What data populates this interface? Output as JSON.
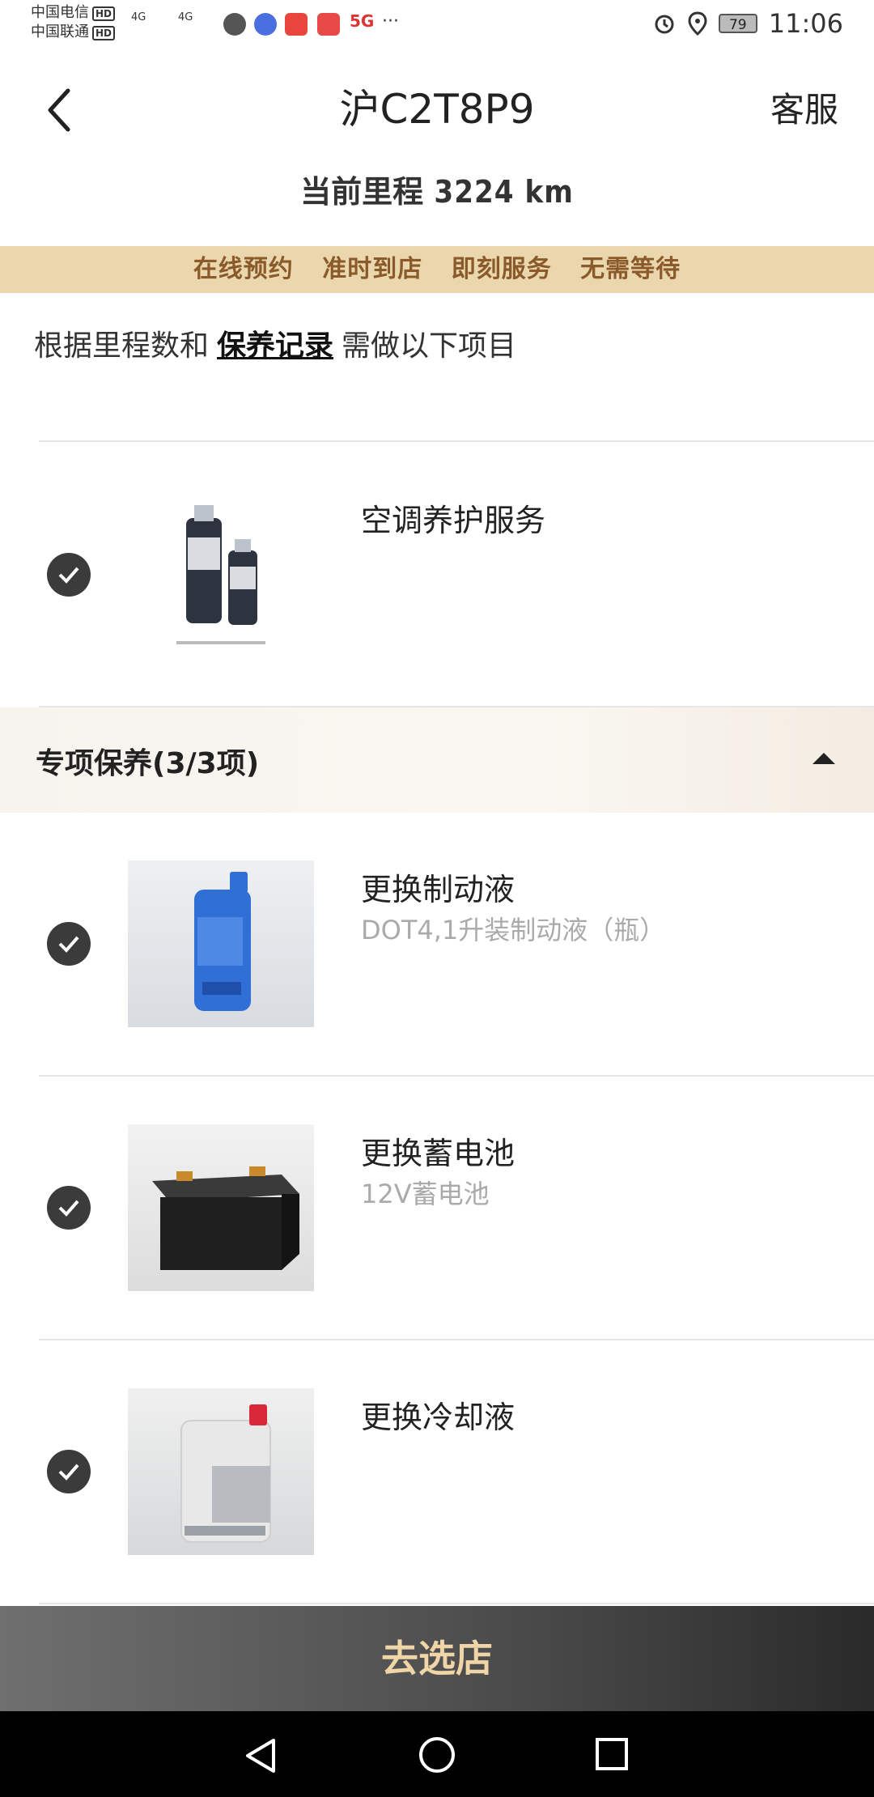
{
  "status_bar": {
    "carrier_1": "中国电信",
    "carrier_2": "中国联通",
    "hd": "HD",
    "signal_1": "4G",
    "signal_2": "4G",
    "network": "5G",
    "more": "···",
    "battery": "79",
    "time": "11:06"
  },
  "header": {
    "title": "沪C2T8P9",
    "service": "客服",
    "mileage_label": "当前里程",
    "mileage_value": "3224 km"
  },
  "promo": [
    "在线预约",
    "准时到店",
    "即刻服务",
    "无需等待"
  ],
  "intro": {
    "before": "根据里程数和",
    "link": "保养记录",
    "after": "需做以下项目"
  },
  "items": [
    {
      "title": "空调养护服务",
      "subtitle": "",
      "checked": true
    },
    {
      "title": "更换制动液",
      "subtitle": "DOT4,1升装制动液（瓶）",
      "checked": true
    },
    {
      "title": "更换蓄电池",
      "subtitle": "12V蓄电池",
      "checked": true
    },
    {
      "title": "更换冷却液",
      "subtitle": "",
      "checked": true
    }
  ],
  "section": {
    "title": "专项保养(3/3项)"
  },
  "cta": {
    "label": "去选店"
  },
  "colors": {
    "promo_bg": "#ead7ae",
    "promo_text": "#8a5a2b",
    "cta_text": "#f0d6a6",
    "check_bg": "#3b3b3b"
  }
}
